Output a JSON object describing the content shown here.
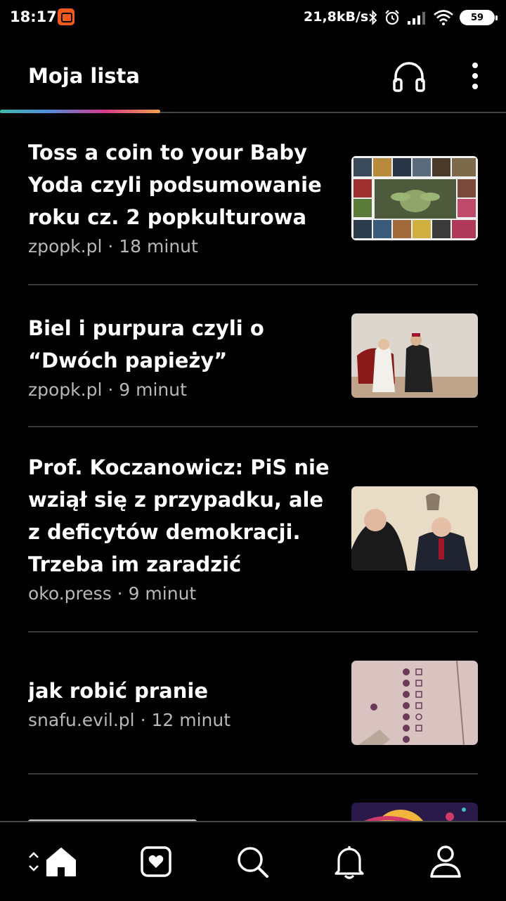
{
  "status_bar": {
    "time": "18:17",
    "net_speed": "21,8kB/s",
    "battery": "59",
    "icons": [
      "app-notification-icon",
      "bluetooth-icon",
      "alarm-icon",
      "signal-icon",
      "wifi-icon",
      "battery-icon"
    ]
  },
  "header": {
    "title": "Moja lista",
    "icons": [
      "headphones-icon",
      "more-vert-icon"
    ],
    "accent_gradient": [
      "#3fb9a8",
      "#4f8fe0",
      "#d63a8a",
      "#f2a04a"
    ]
  },
  "articles": [
    {
      "title": "Toss a coin to your Baby Yoda czyli podsumowanie roku cz. 2 popkulturowa",
      "source": "zpopk.pl",
      "separator": "·",
      "duration": "18 minut"
    },
    {
      "title": "Biel i purpura czyli o “Dwóch papieży”",
      "source": "zpopk.pl",
      "separator": "·",
      "duration": "9 minut"
    },
    {
      "title": "Prof. Koczanowicz: PiS nie wziął się z przypadku, ale z deficytów demokracji. Trzeba im zaradzić",
      "source": "oko.press",
      "separator": "·",
      "duration": "9 minut"
    },
    {
      "title": "jak robić pranie",
      "source": "snafu.evil.pl",
      "separator": "·",
      "duration": "12 minut"
    }
  ],
  "bottom_nav": {
    "items": [
      "home-icon",
      "saved-heart-icon",
      "search-icon",
      "bell-icon",
      "profile-icon"
    ]
  }
}
